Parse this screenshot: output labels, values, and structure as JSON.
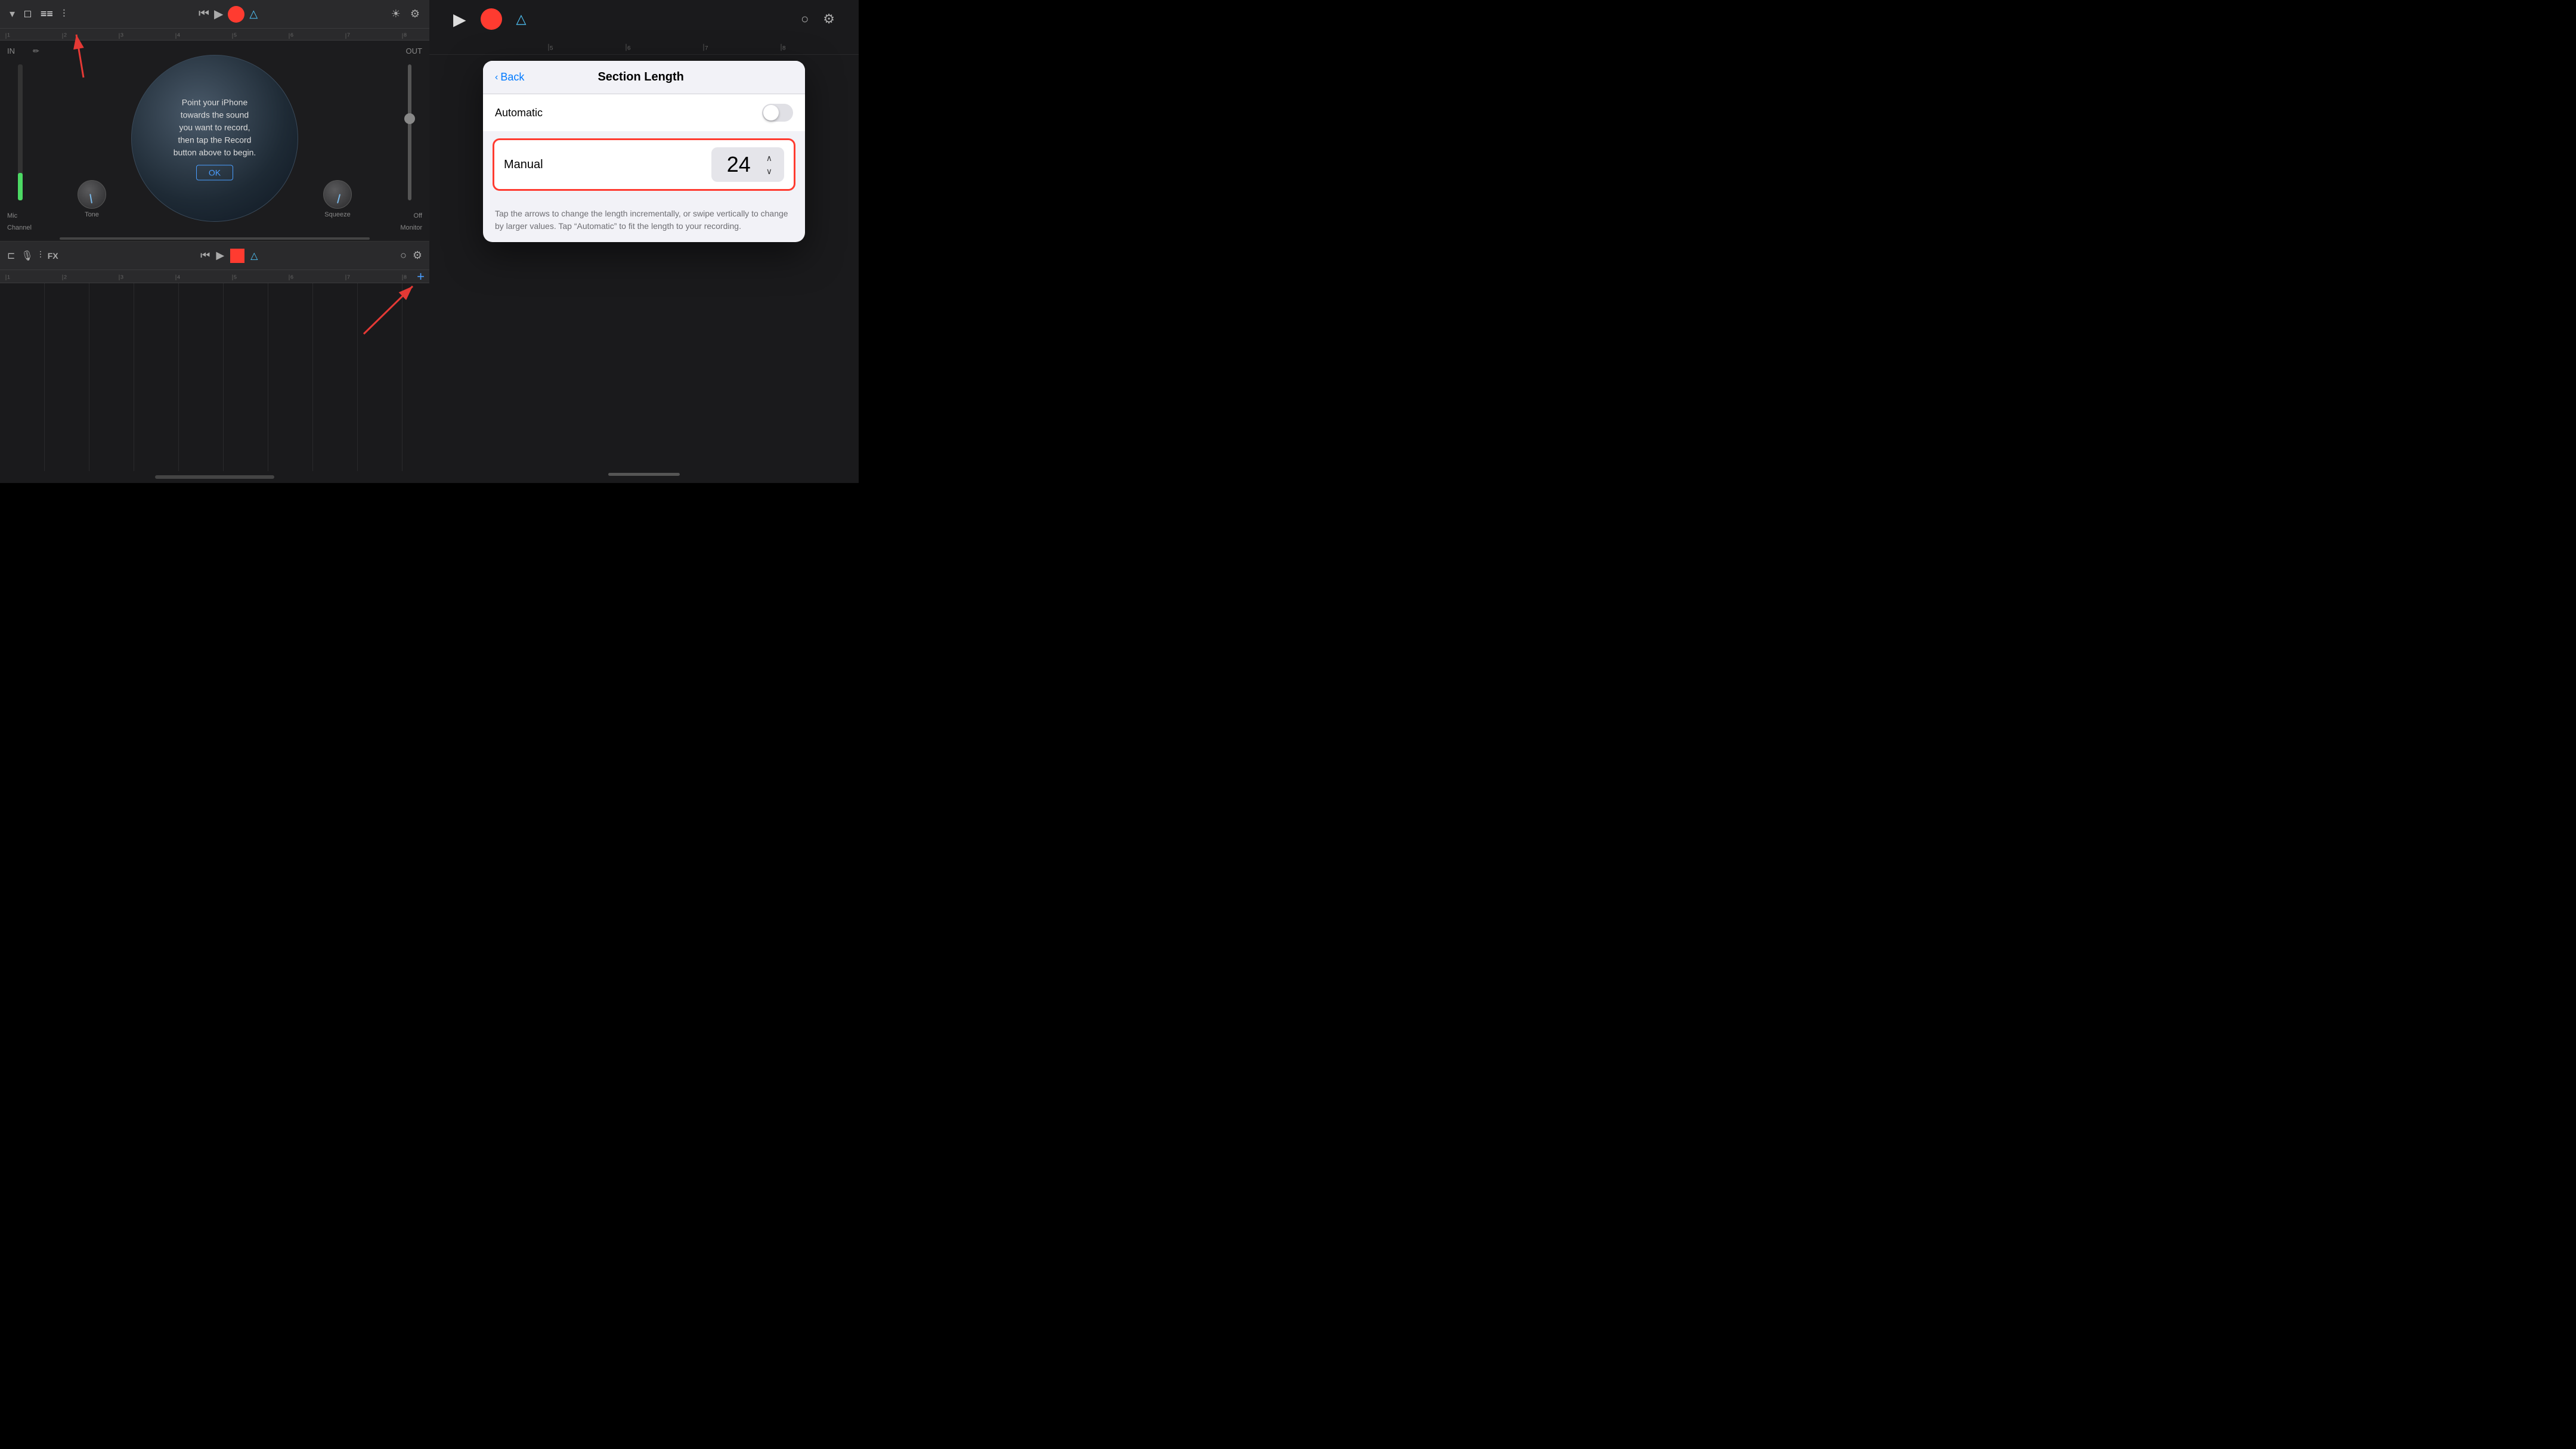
{
  "left_panel": {
    "top_section": {
      "toolbar": {
        "dropdown_icon": "▾",
        "view_icons": [
          "□",
          "≡"
        ],
        "mixer_icon": "⇌",
        "rewind_icon": "⏮",
        "play_icon": "▶",
        "record_label": "●",
        "metronome_icon": "△",
        "brightness_icon": "☀",
        "settings_icon": "⚙"
      },
      "in_label": "IN",
      "out_label": "OUT",
      "dialog": {
        "text": "Point your iPhone towards the sound you want to record, then tap the Record button above to begin.",
        "ok_button": "OK"
      },
      "knobs": {
        "tone_label": "Tone",
        "squeeze_label": "Squeeze"
      },
      "labels": {
        "mic": "Mic",
        "channel": "Channel",
        "off": "Off",
        "monitor": "Monitor"
      }
    },
    "bottom_section": {
      "toolbar": {
        "track_icon": "⊐",
        "mic_icon": "🎙",
        "mixer_icon": "⇌",
        "fx_label": "FX",
        "rewind_icon": "⏮",
        "play_icon": "▶",
        "record_label": "●",
        "metronome_icon": "△",
        "loop_icon": "○",
        "settings_icon": "⚙"
      },
      "add_button": "+"
    }
  },
  "right_panel": {
    "toolbar": {
      "play_icon": "▶",
      "record_label": "●",
      "metronome_icon": "△",
      "loop_icon": "○",
      "settings_icon": "⚙"
    },
    "ruler": {
      "marks": [
        "5",
        "6",
        "7",
        "8"
      ]
    },
    "popover": {
      "back_label": "Back",
      "title": "Section Length",
      "automatic_label": "Automatic",
      "toggle_state": "off",
      "manual_label": "Manual",
      "stepper_value": "24",
      "hint_text": "Tap the arrows to change the length incrementally, or swipe vertically to change by larger values. Tap “Automatic” to fit the length to your recording."
    },
    "home_indicator": true
  }
}
